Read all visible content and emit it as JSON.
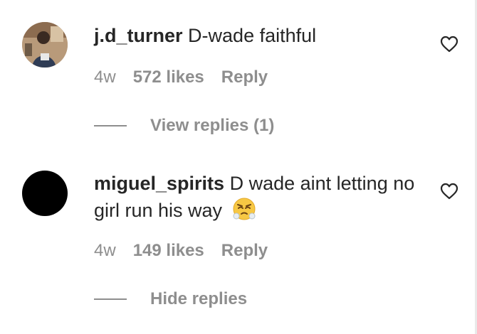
{
  "comments": [
    {
      "username": "j.d_turner",
      "text": "D-wade faithful",
      "time": "4w",
      "likes": "572 likes",
      "reply_label": "Reply",
      "thread_label": "View replies (1)",
      "avatar": "profile-photo",
      "like_icon": "heart-outline-icon"
    },
    {
      "username": "miguel_spirits",
      "text": "D wade aint letting no girl run his way",
      "emoji": "face-with-steam-from-nose-emoji",
      "time": "4w",
      "likes": "149 likes",
      "reply_label": "Reply",
      "thread_label": "Hide replies",
      "avatar": "black-circle",
      "like_icon": "heart-outline-icon"
    }
  ],
  "colors": {
    "text_primary": "#262626",
    "text_secondary": "#8e8e8e",
    "background": "#ffffff"
  }
}
